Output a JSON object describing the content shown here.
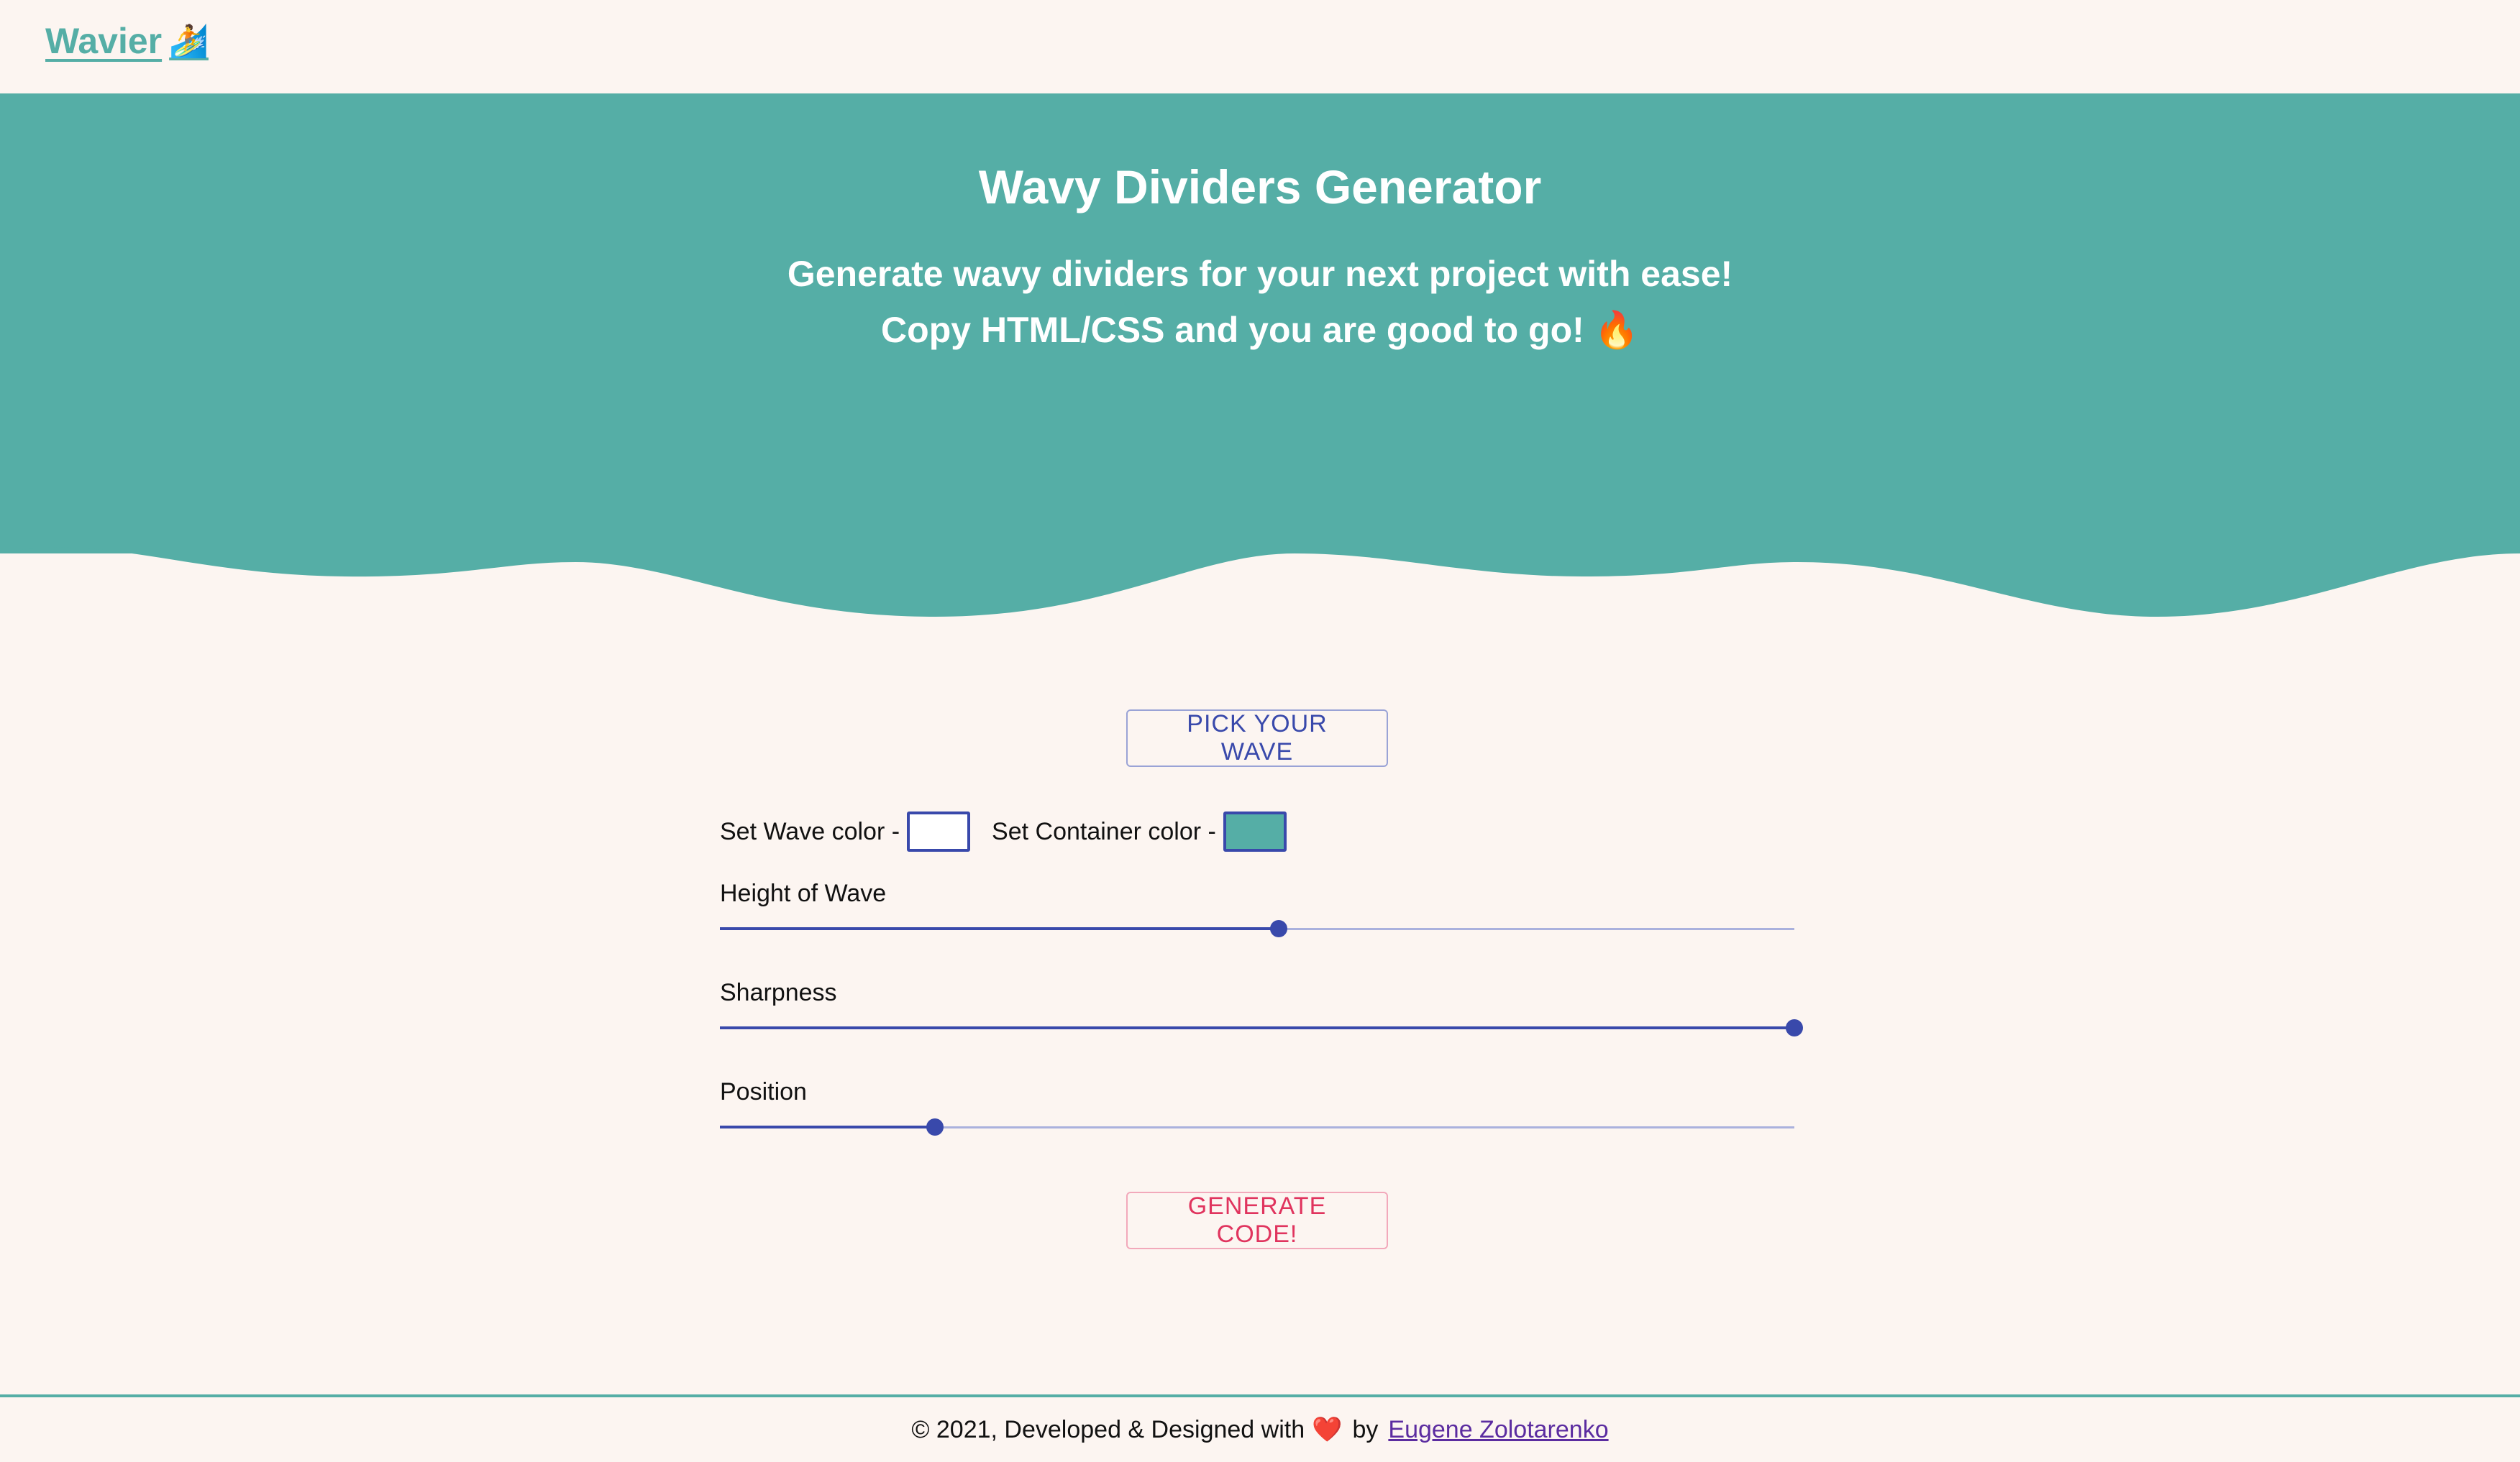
{
  "navbar": {
    "logo_text": "Wavier",
    "logo_icon": "🏄"
  },
  "hero": {
    "title": "Wavy Dividers Generator",
    "subtitle_line1": "Generate wavy dividers for your next project with ease!",
    "subtitle_line2": "Copy HTML/CSS and you are good to go! 🔥",
    "color": "#55aea6"
  },
  "controls": {
    "pick_button": "PICK YOUR WAVE",
    "wave_color_label": "Set Wave color -",
    "wave_color_value": "#ffffff",
    "container_color_label": "Set Container color -",
    "container_color_value": "#55aea6",
    "sliders": [
      {
        "label": "Height of Wave",
        "value": 0.52
      },
      {
        "label": "Sharpness",
        "value": 1.0
      },
      {
        "label": "Position",
        "value": 0.2
      }
    ],
    "generate_button": "GENERATE CODE!"
  },
  "footer": {
    "text_prefix": "© 2021, Developed & Designed with",
    "heart": "❤️",
    "by_text": "by",
    "author_link": "Eugene Zolotarenko"
  },
  "colors": {
    "background": "#fcf5f1",
    "accent": "#55aea6",
    "primary": "#3949ab",
    "danger": "#e0345e"
  }
}
